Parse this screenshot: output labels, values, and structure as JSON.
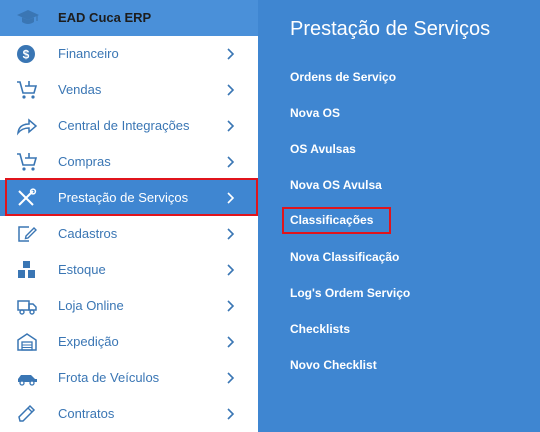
{
  "brand": {
    "title": "EAD Cuca ERP"
  },
  "menu": {
    "items": [
      {
        "label": "Financeiro",
        "icon": "dollar-circle-icon"
      },
      {
        "label": "Vendas",
        "icon": "cart-icon"
      },
      {
        "label": "Central de Integrações",
        "icon": "share-arrow-icon"
      },
      {
        "label": "Compras",
        "icon": "cart-icon"
      },
      {
        "label": "Prestação de Serviços",
        "icon": "tools-icon",
        "active": true
      },
      {
        "label": "Cadastros",
        "icon": "edit-icon"
      },
      {
        "label": "Estoque",
        "icon": "boxes-icon"
      },
      {
        "label": "Loja Online",
        "icon": "truck-icon"
      },
      {
        "label": "Expedição",
        "icon": "warehouse-icon"
      },
      {
        "label": "Frota de Veículos",
        "icon": "car-icon"
      },
      {
        "label": "Contratos",
        "icon": "pen-icon"
      }
    ]
  },
  "panel": {
    "title": "Prestação de Serviços",
    "items": [
      {
        "label": "Ordens de Serviço"
      },
      {
        "label": "Nova OS"
      },
      {
        "label": "OS Avulsas"
      },
      {
        "label": "Nova OS Avulsa"
      },
      {
        "label": "Classificações",
        "highlighted": true
      },
      {
        "label": "Nova Classificação"
      },
      {
        "label": "Log's Ordem Serviço"
      },
      {
        "label": "Checklists"
      },
      {
        "label": "Novo Checklist"
      }
    ]
  },
  "colors": {
    "accent": "#3f86d1",
    "icon": "#3a76b4",
    "highlight": "#e0141c",
    "brand_bar": "#4a90d9"
  }
}
